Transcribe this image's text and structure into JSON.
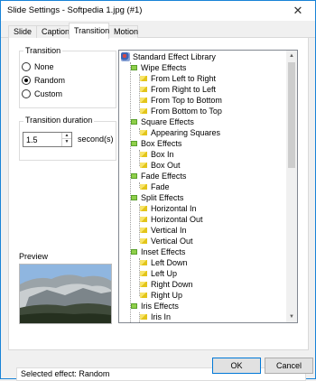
{
  "window": {
    "title": "Slide Settings - Softpedia 1.jpg (#1)",
    "close_glyph": "✕"
  },
  "tabs": [
    {
      "label": "Slide"
    },
    {
      "label": "Caption"
    },
    {
      "label": "Transition",
      "active": true
    },
    {
      "label": "Motion"
    }
  ],
  "transition": {
    "group_label": "Transition",
    "options": [
      {
        "label": "None",
        "checked": false
      },
      {
        "label": "Random",
        "checked": true
      },
      {
        "label": "Custom",
        "checked": false
      }
    ]
  },
  "duration": {
    "group_label": "Transition duration",
    "value": "1.5",
    "unit": "second(s)"
  },
  "preview": {
    "label": "Preview"
  },
  "effects_tree": {
    "root": "Standard Effect Library",
    "groups": [
      {
        "name": "Wipe Effects",
        "items": [
          "From Left to Right",
          "From Right to Left",
          "From Top to Bottom",
          "From Bottom to Top"
        ]
      },
      {
        "name": "Square Effects",
        "items": [
          "Appearing Squares"
        ]
      },
      {
        "name": "Box Effects",
        "items": [
          "Box In",
          "Box Out"
        ]
      },
      {
        "name": "Fade Effects",
        "items": [
          "Fade"
        ]
      },
      {
        "name": "Split Effects",
        "items": [
          "Horizontal In",
          "Horizontal Out",
          "Vertical In",
          "Vertical Out"
        ]
      },
      {
        "name": "Inset Effects",
        "items": [
          "Left Down",
          "Left Up",
          "Right Down",
          "Right Up"
        ]
      },
      {
        "name": "Iris Effects",
        "items": [
          "Iris In"
        ]
      }
    ]
  },
  "status": {
    "text": "Selected effect: Random"
  },
  "buttons": {
    "ok": "OK",
    "cancel": "Cancel"
  },
  "colors": {
    "accent": "#0078d7",
    "window_border": "#1883d7"
  }
}
